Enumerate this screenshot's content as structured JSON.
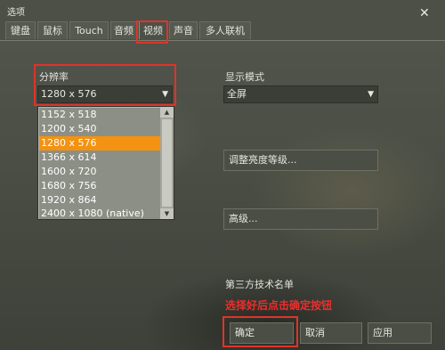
{
  "window": {
    "title": "选项",
    "close_glyph": "✕"
  },
  "tabs": [
    {
      "label": "键盘"
    },
    {
      "label": "鼠标"
    },
    {
      "label": "Touch"
    },
    {
      "label": "音频"
    },
    {
      "label": "视频",
      "active": true
    },
    {
      "label": "声音"
    },
    {
      "label": "多人联机"
    }
  ],
  "resolution": {
    "label": "分辨率",
    "selected": "1280 x 576",
    "options": [
      "1152 x 518",
      "1200 x 540",
      "1280 x 576",
      "1366 x 614",
      "1600 x 720",
      "1680 x 756",
      "1920 x 864",
      "2400 x 1080 (native)"
    ],
    "selected_index": 2
  },
  "display_mode": {
    "label": "显示模式",
    "selected": "全屏"
  },
  "buttons": {
    "brightness": "调整亮度等级...",
    "advanced": "高级...",
    "third_party": "第三方技术名单",
    "ok": "确定",
    "cancel": "取消",
    "apply": "应用"
  },
  "annotation": "选择好后点击确定按钮",
  "colors": {
    "highlight_red": "#e0332a",
    "selected_item": "#f49211"
  }
}
